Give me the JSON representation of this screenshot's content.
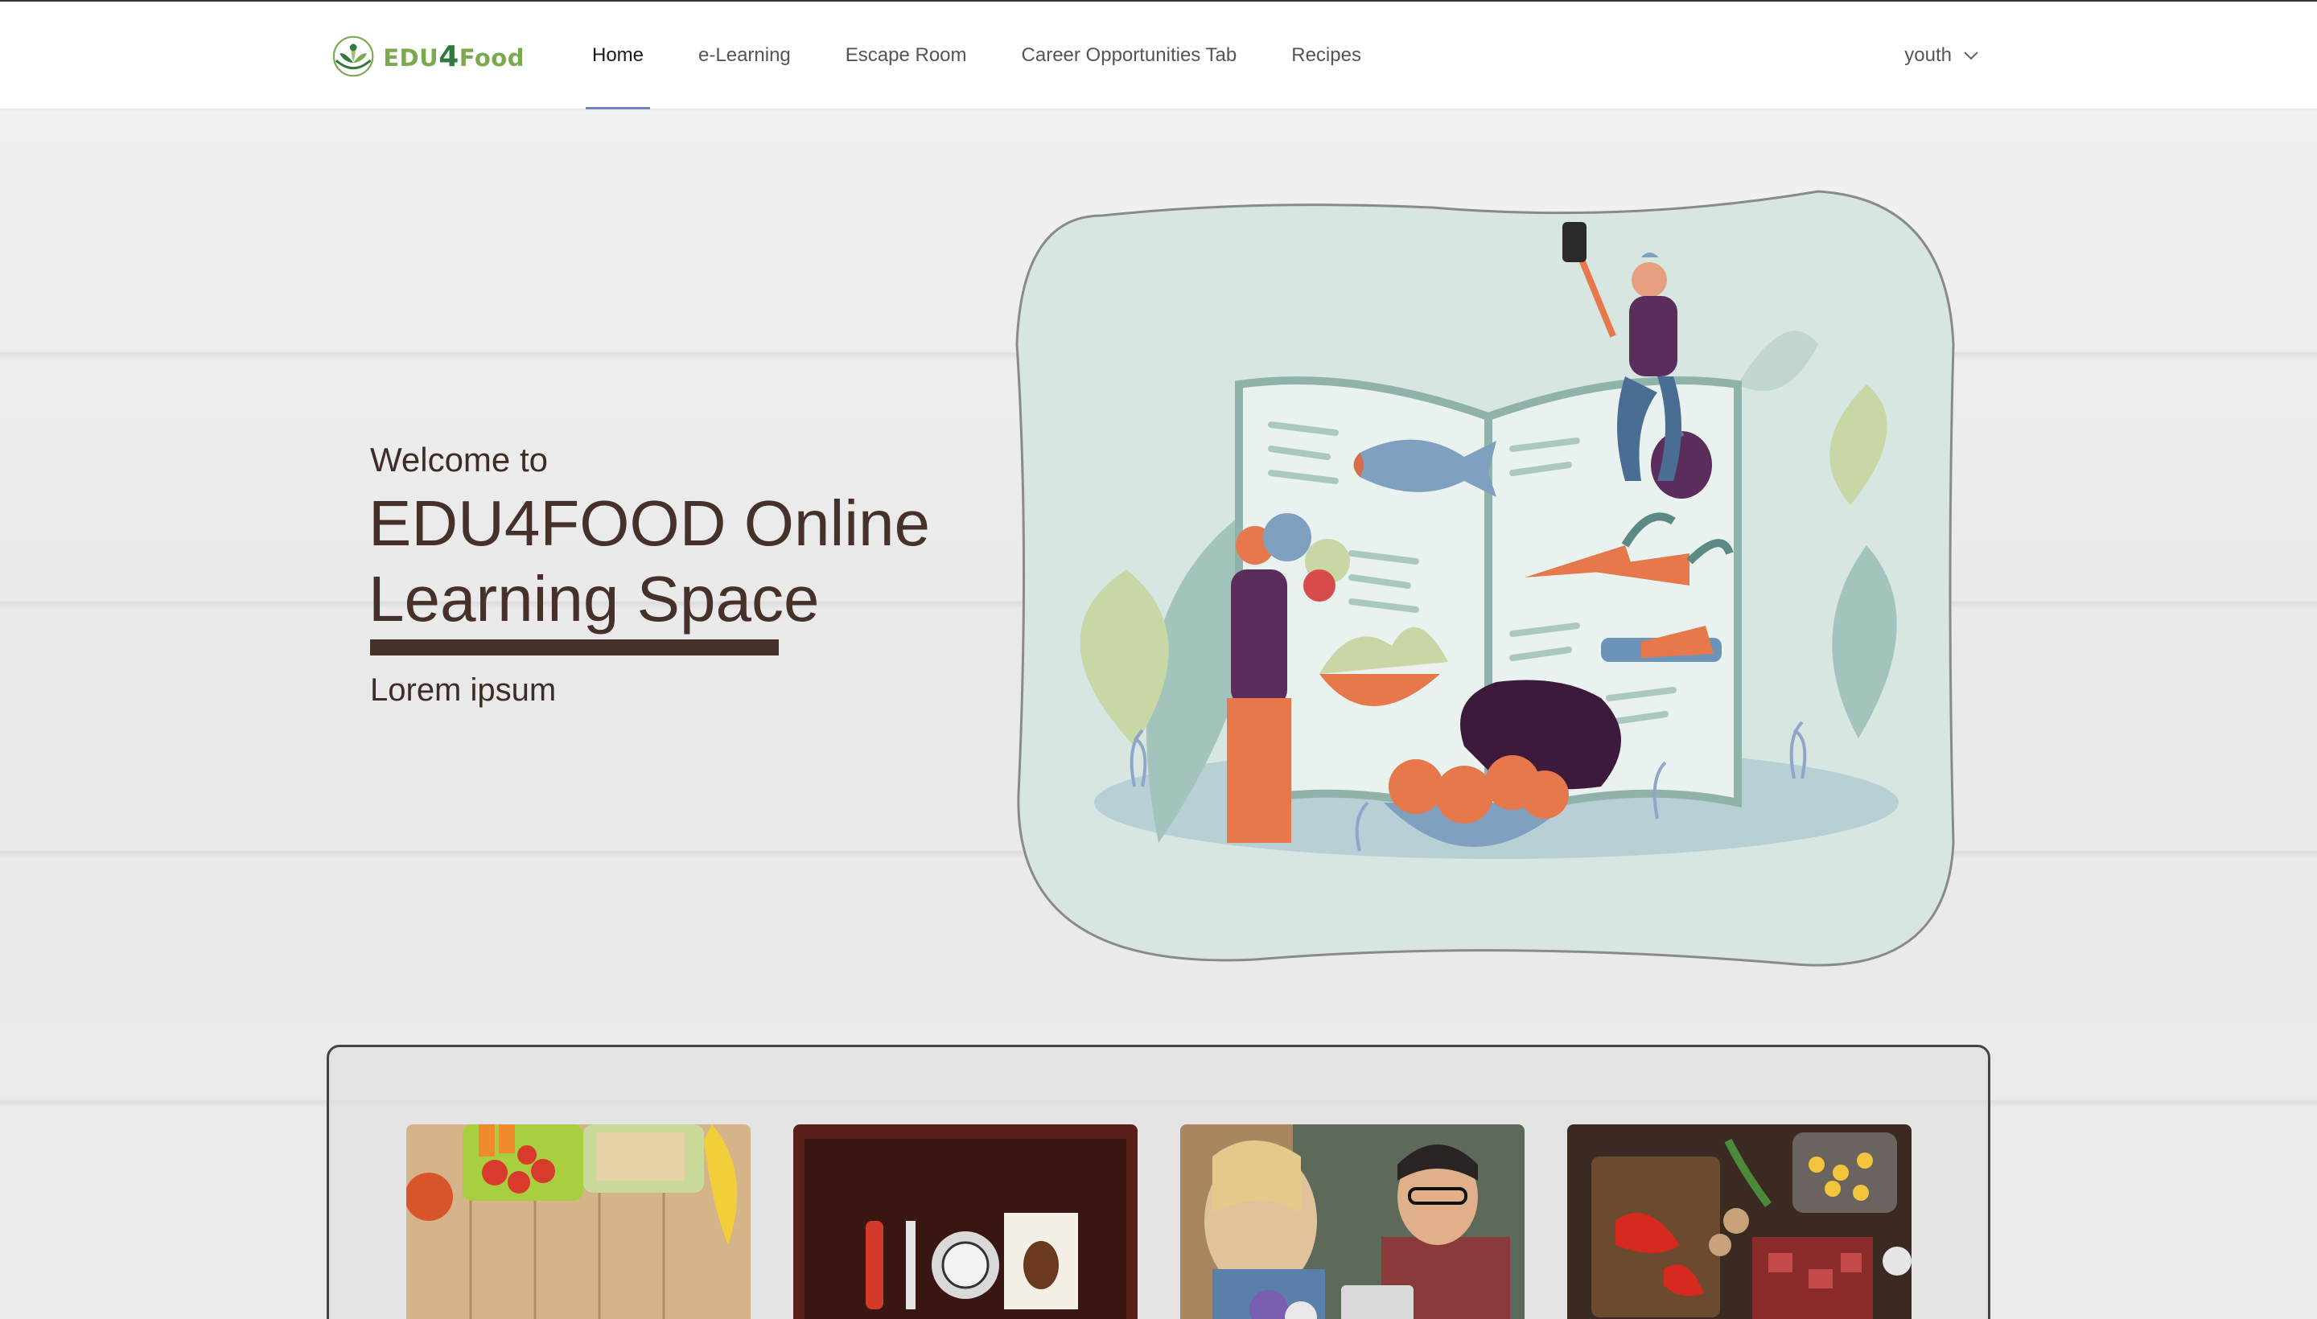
{
  "app": {
    "logo_text_prefix": "EDU",
    "logo_text_four": "4",
    "logo_text_suffix": "Food"
  },
  "nav": {
    "items": [
      {
        "label": "Home",
        "active": true
      },
      {
        "label": "e-Learning",
        "active": false
      },
      {
        "label": "Escape Room",
        "active": false
      },
      {
        "label": "Career Opportunities Tab",
        "active": false
      },
      {
        "label": "Recipes",
        "active": false
      }
    ],
    "user_menu_label": "youth",
    "user_menu_icon": "chevron-down-icon"
  },
  "hero": {
    "welcome": "Welcome to",
    "title": "EDU4FOOD Online Learning Space",
    "subtitle": "Lorem ipsum"
  },
  "colors": {
    "brand_green": "#7aaa4d",
    "brand_dark_green": "#2f7a3c",
    "title_brown": "#45302a",
    "nav_active_underline": "#6f81c9"
  },
  "cards": [
    {
      "name": "healthy-lunchbox-image"
    },
    {
      "name": "survival-kit-image"
    },
    {
      "name": "florist-tablet-image"
    },
    {
      "name": "cooking-ingredients-image"
    }
  ]
}
